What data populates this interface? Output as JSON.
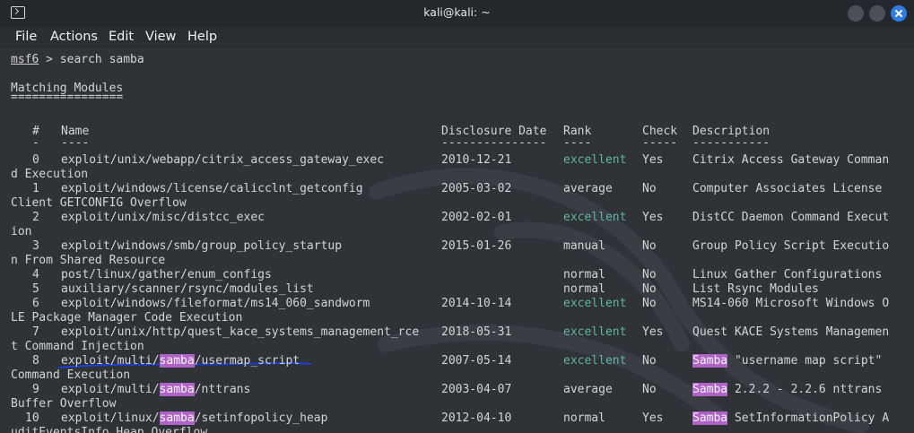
{
  "window": {
    "title": "kali@kali: ~"
  },
  "menu": [
    "File",
    "Actions",
    "Edit",
    "View",
    "Help"
  ],
  "terminal": {
    "prompt": "msf6",
    "command": " > search samba",
    "section_title": "Matching Modules",
    "section_rule": "================",
    "headers": {
      "num": "#",
      "name": "Name",
      "date": "Disclosure Date",
      "rank": "Rank",
      "check": "Check",
      "desc": "Description"
    },
    "header_rules": {
      "num": "-",
      "name": "----",
      "date": "---------------",
      "rank": "----",
      "check": "-----",
      "desc": "-----------"
    },
    "search_term": "samba",
    "rows": [
      {
        "num": "0",
        "name": "exploit/unix/webapp/citrix_access_gateway_exec",
        "date": "2010-12-21",
        "rank": "excellent",
        "check": "Yes",
        "desc": "Citrix Access Gateway Comman",
        "wrap": "d Execution"
      },
      {
        "num": "1",
        "name": "exploit/windows/license/calicclnt_getconfig",
        "date": "2005-03-02",
        "rank": "average",
        "check": "No",
        "desc": "Computer Associates License",
        "wrap": "Client GETCONFIG Overflow"
      },
      {
        "num": "2",
        "name": "exploit/unix/misc/distcc_exec",
        "date": "2002-02-01",
        "rank": "excellent",
        "check": "Yes",
        "desc": "DistCC Daemon Command Execut",
        "wrap": "ion"
      },
      {
        "num": "3",
        "name": "exploit/windows/smb/group_policy_startup",
        "date": "2015-01-26",
        "rank": "manual",
        "check": "No",
        "desc": "Group Policy Script Executio",
        "wrap": "n From Shared Resource"
      },
      {
        "num": "4",
        "name": "post/linux/gather/enum_configs",
        "date": "",
        "rank": "normal",
        "check": "No",
        "desc": "Linux Gather Configurations",
        "wrap": ""
      },
      {
        "num": "5",
        "name": "auxiliary/scanner/rsync/modules_list",
        "date": "",
        "rank": "normal",
        "check": "No",
        "desc": "List Rsync Modules",
        "wrap": ""
      },
      {
        "num": "6",
        "name": "exploit/windows/fileformat/ms14_060_sandworm",
        "date": "2014-10-14",
        "rank": "excellent",
        "check": "No",
        "desc": "MS14-060 Microsoft Windows O",
        "wrap": "LE Package Manager Code Execution"
      },
      {
        "num": "7",
        "name": "exploit/unix/http/quest_kace_systems_management_rce",
        "date": "2018-05-31",
        "rank": "excellent",
        "check": "Yes",
        "desc": "Quest KACE Systems Managemen",
        "wrap": "t Command Injection"
      },
      {
        "num": "8",
        "name": "exploit/multi/samba/usermap_script",
        "date": "2007-05-14",
        "rank": "excellent",
        "check": "No",
        "desc": "Samba \"username map script\"",
        "wrap": "Command Execution"
      },
      {
        "num": "9",
        "name": "exploit/multi/samba/nttrans",
        "date": "2003-04-07",
        "rank": "average",
        "check": "No",
        "desc": "Samba 2.2.2 - 2.2.6 nttrans",
        "wrap": "Buffer Overflow"
      },
      {
        "num": "10",
        "name": "exploit/linux/samba/setinfopolicy_heap",
        "date": "2012-04-10",
        "rank": "normal",
        "check": "Yes",
        "desc": "Samba SetInformationPolicy A",
        "wrap": "uditEventsInfo Heap Overflow"
      }
    ]
  },
  "colors": {
    "excellent_rank": "#5fb59d",
    "search_highlight": "#b063c6",
    "annotation_underline": "#1e3fd6"
  }
}
